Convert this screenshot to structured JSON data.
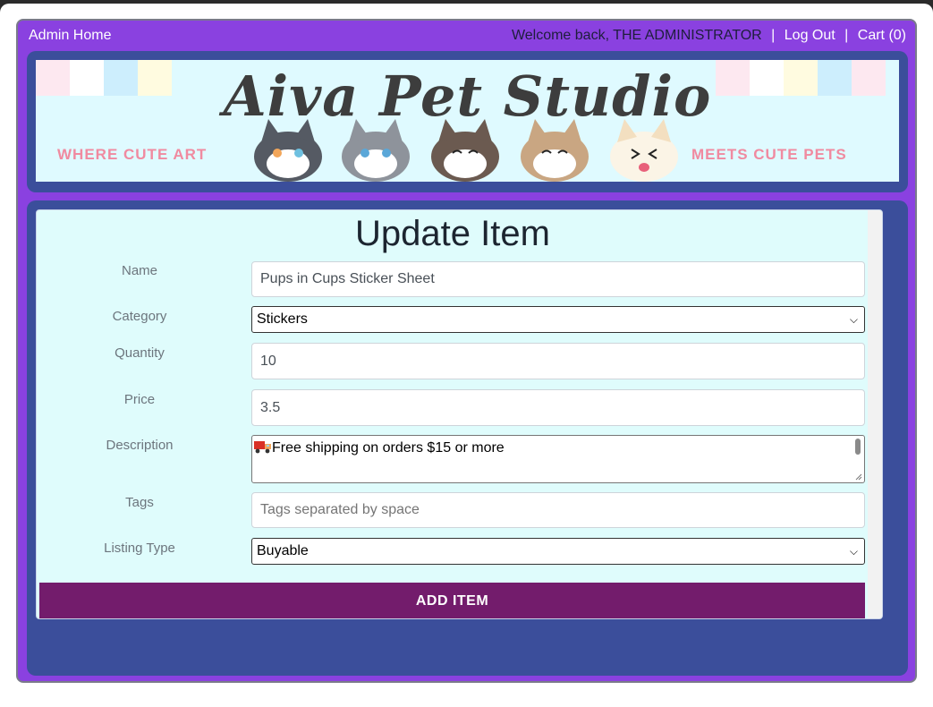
{
  "topbar": {
    "home_link": "Admin Home",
    "welcome_text": "Welcome back, THE ADMINISTRATOR",
    "separator": "|",
    "logout_link": "Log Out",
    "cart_link": "Cart (0)"
  },
  "banner": {
    "logo_text": "Aiva Pet Studio",
    "tagline_left": "WHERE CUTE ART",
    "tagline_right": "MEETS CUTE PETS"
  },
  "form": {
    "title": "Update Item",
    "name_label": "Name",
    "name_value": "Pups in Cups Sticker Sheet",
    "category_label": "Category",
    "category_value": "Stickers",
    "quantity_label": "Quantity",
    "quantity_value": "10",
    "price_label": "Price",
    "price_value": "3.5",
    "description_label": "Description",
    "description_value": "Free shipping on orders $15 or more",
    "tags_label": "Tags",
    "tags_placeholder": "Tags separated by space",
    "listing_type_label": "Listing Type",
    "listing_type_value": "Buyable",
    "submit_label": "ADD ITEM"
  },
  "colors": {
    "frame": "#8a41e0",
    "panel": "#3b4e9b",
    "card": "#dffcfc",
    "button": "#731c6c"
  },
  "icons": [
    "chevron-down-icon",
    "truck-emoji-icon"
  ]
}
